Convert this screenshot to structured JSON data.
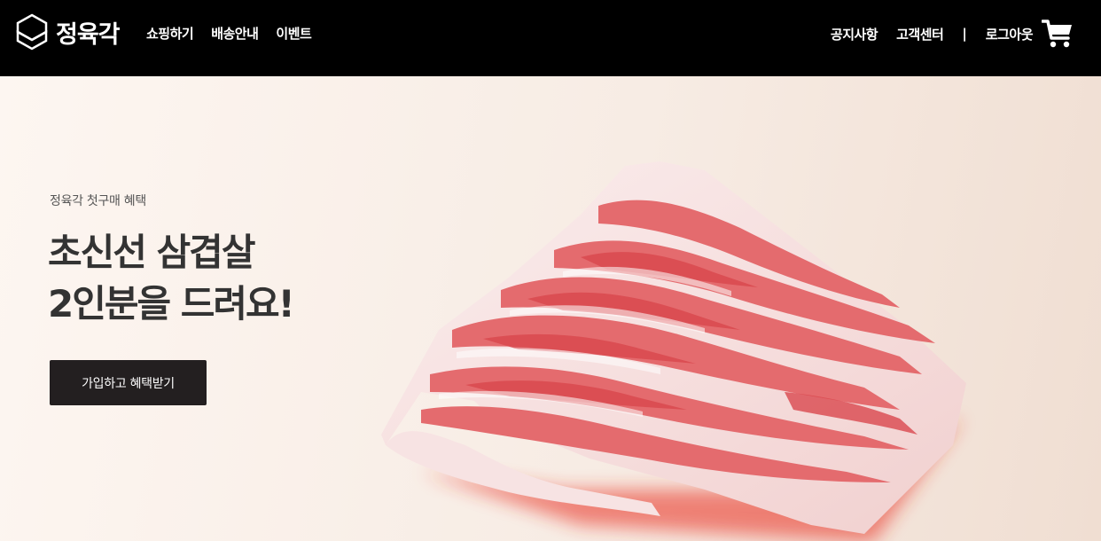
{
  "header": {
    "logo_text": "정육각",
    "nav_left": [
      "쇼핑하기",
      "배송안내",
      "이벤트"
    ],
    "notice": "공지사항",
    "support": "고객센터",
    "separator": "|",
    "logout": "로그아웃",
    "cart_icon": "shopping-cart-icon"
  },
  "hero": {
    "eyebrow": "정육각 첫구매 혜택",
    "headline_line1": "초신선 삼겹살",
    "headline_line2": "2인분을 드려요!",
    "cta_label": "가입하고 혜택받기",
    "image": "pork-belly-image"
  },
  "colors": {
    "nav_bg": "#000000",
    "cta_bg": "#231f20",
    "headline": "#333333"
  }
}
